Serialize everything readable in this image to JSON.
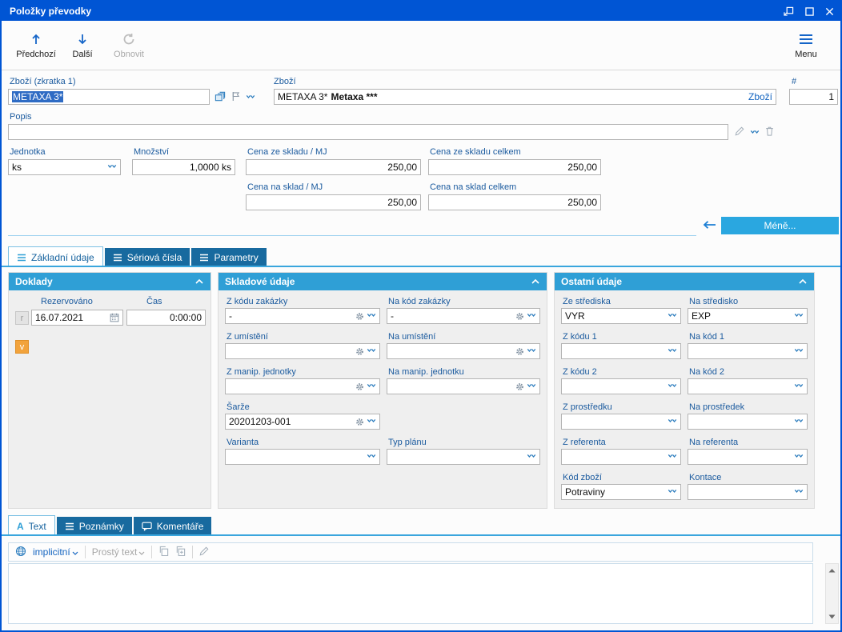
{
  "titlebar": {
    "title": "Položky převodky"
  },
  "toolbar": {
    "previous": "Předchozí",
    "next": "Další",
    "refresh": "Obnovit",
    "menu": "Menu"
  },
  "form": {
    "shortcut_label": "Zboží (zkratka 1)",
    "shortcut_value": "METAXA 3*",
    "goods_label": "Zboží",
    "goods_code": "METAXA 3*",
    "goods_name": "Metaxa ***",
    "goods_link": "Zboží",
    "number_label": "#",
    "number_value": "1",
    "description_label": "Popis",
    "description_value": "",
    "unit_label": "Jednotka",
    "unit_value": "ks",
    "quantity_label": "Množství",
    "quantity_value": "1,0000 ks",
    "price_out_mj_label": "Cena ze skladu / MJ",
    "price_out_mj_value": "250,00",
    "price_out_total_label": "Cena ze skladu celkem",
    "price_out_total_value": "250,00",
    "price_in_mj_label": "Cena na sklad / MJ",
    "price_in_mj_value": "250,00",
    "price_in_total_label": "Cena na sklad celkem",
    "price_in_total_value": "250,00",
    "less_button": "Méně..."
  },
  "tabs": {
    "basic": "Základní údaje",
    "serial": "Sériová čísla",
    "params": "Parametry"
  },
  "doklady": {
    "title": "Doklady",
    "col_reserved": "Rezervováno",
    "col_time": "Čas",
    "btn_r": "r",
    "date": "16.07.2021",
    "time": "0:00:00",
    "btn_v": "v"
  },
  "sklad": {
    "title": "Skladové údaje",
    "rows": {
      "from_order_label": "Z kódu zakázky",
      "from_order_value": "-",
      "to_order_label": "Na kód zakázky",
      "to_order_value": "-",
      "from_loc_label": "Z umístění",
      "from_loc_value": "",
      "to_loc_label": "Na umístění",
      "to_loc_value": "",
      "from_mu_label": "Z manip. jednotky",
      "from_mu_value": "",
      "to_mu_label": "Na manip. jednotku",
      "to_mu_value": "",
      "batch_label": "Šarže",
      "batch_value": "20201203-001",
      "variant_label": "Varianta",
      "variant_value": "",
      "plan_label": "Typ plánu",
      "plan_value": ""
    }
  },
  "ostatni": {
    "title": "Ostatní údaje",
    "rows": {
      "from_center_label": "Ze střediska",
      "from_center_value": "VYR",
      "to_center_label": "Na středisko",
      "to_center_value": "EXP",
      "from_code1_label": "Z kódu 1",
      "from_code1_value": "",
      "to_code1_label": "Na kód 1",
      "to_code1_value": "",
      "from_code2_label": "Z kódu 2",
      "from_code2_value": "",
      "to_code2_label": "Na kód 2",
      "to_code2_value": "",
      "from_res_label": "Z prostředku",
      "from_res_value": "",
      "to_res_label": "Na prostředek",
      "to_res_value": "",
      "from_ref_label": "Z referenta",
      "from_ref_value": "",
      "to_ref_label": "Na referenta",
      "to_ref_value": "",
      "goods_code_label": "Kód zboží",
      "goods_code_value": "Potraviny",
      "konto_label": "Kontace",
      "konto_value": ""
    }
  },
  "bottom_tabs": {
    "text": "Text",
    "notes": "Poznámky",
    "comments": "Komentáře"
  },
  "editor": {
    "language": "implicitní",
    "format": "Prostý text"
  },
  "icons": {
    "text_tab": "A",
    "previous": "arrow-up",
    "next": "arrow-down",
    "refresh": "circular-arrow",
    "menu": "hamburger",
    "lookup": "cards-stack",
    "flag": "flag",
    "dropdown": "double-chevron-down",
    "gear": "gear",
    "calendar": "calendar",
    "pencil": "pencil",
    "trash": "trash",
    "collapse": "chevron-up",
    "globe": "globe",
    "comment": "speech-bubble",
    "copy": "copy"
  },
  "colors": {
    "titlebar": "#0055d4",
    "accent": "#2f9fd6",
    "tab_inactive": "#186a9f",
    "less_button": "#2aa7e0",
    "selection": "#2e6bc4"
  }
}
